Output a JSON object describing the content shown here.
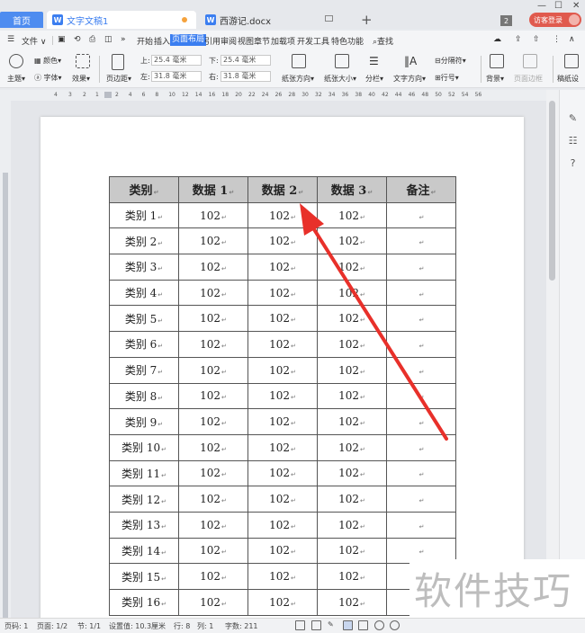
{
  "tabs": {
    "home": "首页",
    "doc1": "文字文稿1",
    "doc2": "西游记.docx",
    "count": "2",
    "visitor_login": "访客登录"
  },
  "menu": {
    "file": "文件",
    "items": [
      "开始",
      "插入",
      "页面布局",
      "引用",
      "审阅",
      "视图",
      "章节",
      "加载项",
      "开发工具",
      "特色功能"
    ],
    "search": "查找"
  },
  "ribbon": {
    "theme": "主题",
    "colors": "颜色",
    "fonts": "字体",
    "effects": "效果",
    "margins": "页边距",
    "top_label": "上:",
    "top_value": "25.4 毫米",
    "bottom_label": "下:",
    "bottom_value": "25.4 毫米",
    "left_label": "左:",
    "left_value": "31.8 毫米",
    "right_label": "右:",
    "right_value": "31.8 毫米",
    "orientation": "纸张方向",
    "size": "纸张大小",
    "columns": "分栏",
    "text_direction": "文字方向",
    "breaks": "分隔符",
    "line_numbers": "行号",
    "background": "背景",
    "page_border": "页面边框",
    "manuscript": "稿纸设"
  },
  "ruler": {
    "left_numbers": [
      "4",
      "3",
      "2",
      "1"
    ],
    "numbers": [
      "2",
      "4",
      "6",
      "8",
      "10",
      "12",
      "14",
      "16",
      "18",
      "20",
      "22",
      "24",
      "26",
      "28",
      "30",
      "32",
      "34",
      "36",
      "38",
      "40",
      "42",
      "44",
      "46",
      "48",
      "50",
      "52",
      "54",
      "56"
    ]
  },
  "table": {
    "headers": [
      "类别",
      "数据 1",
      "数据 2",
      "数据 3",
      "备注"
    ],
    "rows": [
      [
        "类别 1",
        "102",
        "102",
        "102",
        ""
      ],
      [
        "类别 2",
        "102",
        "102",
        "102",
        ""
      ],
      [
        "类别 3",
        "102",
        "102",
        "102",
        ""
      ],
      [
        "类别 4",
        "102",
        "102",
        "102",
        ""
      ],
      [
        "类别 5",
        "102",
        "102",
        "102",
        ""
      ],
      [
        "类别 6",
        "102",
        "102",
        "102",
        ""
      ],
      [
        "类别 7",
        "102",
        "102",
        "102",
        ""
      ],
      [
        "类别 8",
        "102",
        "102",
        "102",
        ""
      ],
      [
        "类别 9",
        "102",
        "102",
        "102",
        ""
      ],
      [
        "类别 10",
        "102",
        "102",
        "102",
        ""
      ],
      [
        "类别 11",
        "102",
        "102",
        "102",
        ""
      ],
      [
        "类别 12",
        "102",
        "102",
        "102",
        ""
      ],
      [
        "类别 13",
        "102",
        "102",
        "102",
        ""
      ],
      [
        "类别 14",
        "102",
        "102",
        "102",
        ""
      ],
      [
        "类别 15",
        "102",
        "102",
        "102",
        ""
      ],
      [
        "类别 16",
        "102",
        "102",
        "102",
        ""
      ]
    ]
  },
  "status": {
    "page_num": "页码: 1",
    "pages": "页面: 1/2",
    "section": "节: 1/1",
    "setting": "设置值: 10.3厘米",
    "row": "行: 8",
    "col": "列: 1",
    "words": "字数: 211"
  },
  "watermark": "软件技巧",
  "colors": {
    "accent": "#3b7ef0",
    "header_fill": "#c9c9c9",
    "arrow": "#e8302a",
    "visitor": "#e05a4e"
  }
}
